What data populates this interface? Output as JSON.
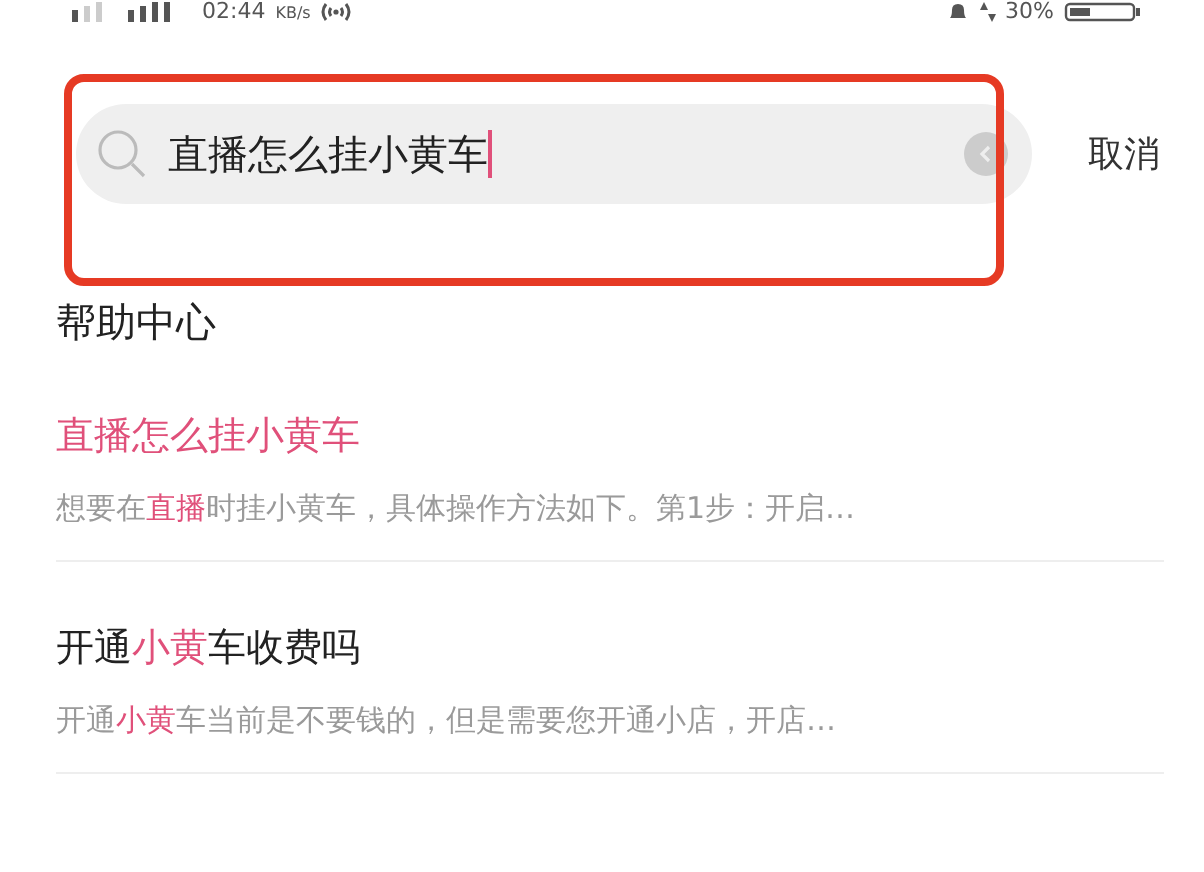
{
  "status_bar": {
    "time": "02:44",
    "speed_unit": "KB/s",
    "battery": "30%"
  },
  "search": {
    "value": "直播怎么挂小黄车",
    "cancel": "取消"
  },
  "section_title": "帮助中心",
  "results": [
    {
      "title": [
        {
          "text": "直播怎么挂小黄车",
          "highlight": true
        }
      ],
      "snippet": [
        {
          "text": "想要在",
          "highlight": false
        },
        {
          "text": "直播",
          "highlight": true
        },
        {
          "text": "时挂小黄车，具体操作方法如下。第1步：开启…",
          "highlight": false
        }
      ]
    },
    {
      "title": [
        {
          "text": "开通",
          "highlight": false
        },
        {
          "text": "小黄",
          "highlight": true
        },
        {
          "text": "车收费吗",
          "highlight": false
        }
      ],
      "snippet": [
        {
          "text": "开通",
          "highlight": false
        },
        {
          "text": "小黄",
          "highlight": true
        },
        {
          "text": "车当前是不要钱的，但是需要您开通小店，开店…",
          "highlight": false
        }
      ]
    }
  ]
}
